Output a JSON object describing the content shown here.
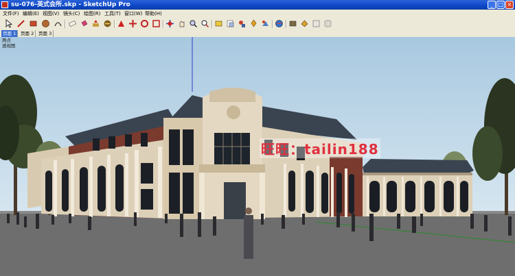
{
  "window": {
    "title": "su-076-英式会所.skp - SketchUp Pro"
  },
  "menu": [
    "文件(F)",
    "编辑(E)",
    "视图(V)",
    "镜头(C)",
    "绘图(R)",
    "工具(T)",
    "窗口(W)",
    "帮助(H)"
  ],
  "toolbar": {
    "tools": [
      "select-icon",
      "pencil-icon",
      "rectangle-icon",
      "circle-icon",
      "arc-icon",
      "eraser-icon",
      "paint-bucket-icon",
      "push-pull-icon",
      "follow-me-icon",
      "offset-icon",
      "move-icon",
      "rotate-icon",
      "scale-icon",
      "orbit-icon",
      "pan-icon",
      "zoom-icon",
      "zoom-extents-icon",
      "tape-measure-icon",
      "text-icon",
      "dimension-icon",
      "section-icon",
      "walk-icon",
      "look-around-icon",
      "position-camera-icon",
      "components-icon",
      "materials-icon",
      "styles-icon"
    ]
  },
  "tabs": [
    {
      "label": "页面 1",
      "active": true
    },
    {
      "label": "页面 2",
      "active": false
    },
    {
      "label": "页面 3",
      "active": false
    }
  ],
  "viewport": {
    "labels": [
      "两点",
      "透视图"
    ],
    "watermark": "旺旺：tailin188",
    "colors": {
      "sky": "#bcd6e8",
      "ground": "#707070",
      "facade": "#ddd0b8",
      "roof": "#3a4450",
      "brick": "#7a3a2e"
    }
  }
}
